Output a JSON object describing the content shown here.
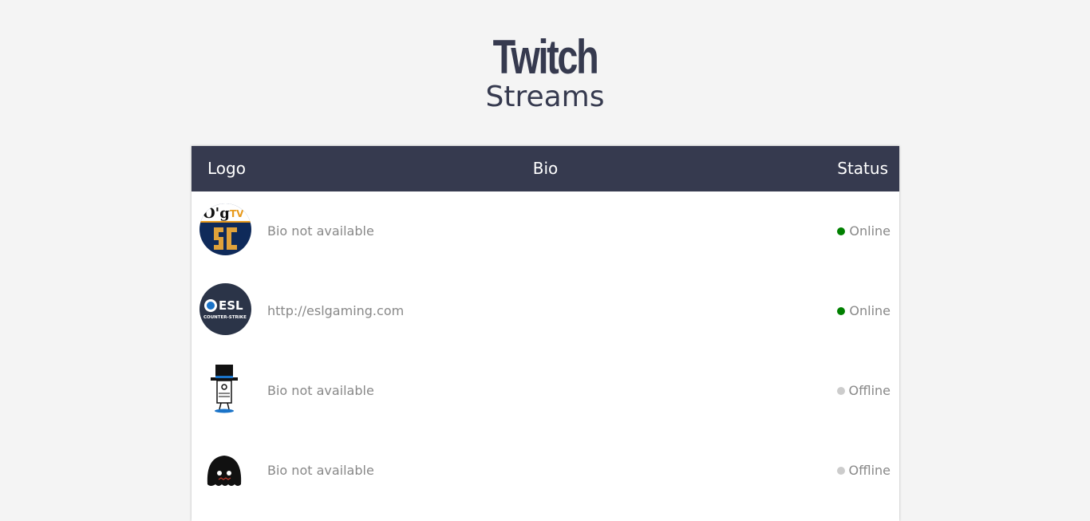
{
  "header": {
    "title": "Twitch",
    "subtitle": "Streams"
  },
  "table": {
    "columns": {
      "logo": "Logo",
      "bio": "Bio",
      "status": "Status"
    },
    "rows": [
      {
        "logo_icon": "ogtv-starcraft-logo",
        "bio": "Bio not available",
        "status": "Online",
        "status_color": "#008000"
      },
      {
        "logo_icon": "esl-counter-strike-logo",
        "bio": "http://eslgaming.com",
        "status": "Online",
        "status_color": "#008000"
      },
      {
        "logo_icon": "top-hat-character-logo",
        "bio": "Bio not available",
        "status": "Offline",
        "status_color": "#cccccc"
      },
      {
        "logo_icon": "black-blob-character-logo",
        "bio": "Bio not available",
        "status": "Offline",
        "status_color": "#cccccc"
      }
    ]
  },
  "colors": {
    "header_bg": "#363a4f",
    "page_bg": "#f4f4f4",
    "online": "#008000",
    "offline": "#cccccc"
  }
}
